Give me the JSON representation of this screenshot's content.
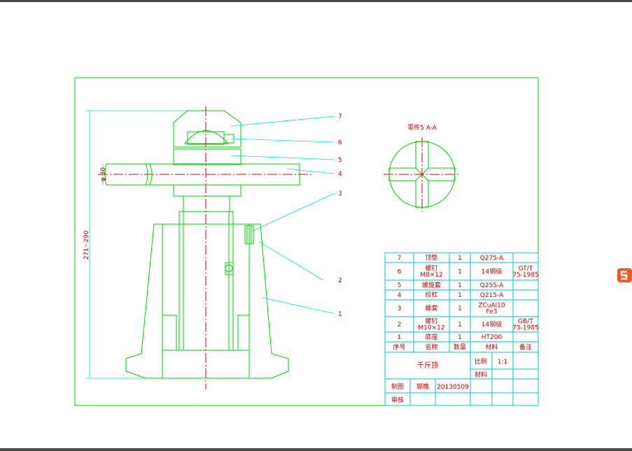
{
  "drawing": {
    "title": "千斤顶",
    "section_label": "零件5 A-A",
    "dim_height": "271~290",
    "dim_diameter": "φ 30",
    "leaders": [
      "7",
      "6",
      "5",
      "4",
      "3",
      "2",
      "1"
    ]
  },
  "bom": {
    "rows": [
      {
        "no": "7",
        "name": "顶垫",
        "qty": "1",
        "material": "Q275-A",
        "note": ""
      },
      {
        "no": "6",
        "name": "螺钉 M8×12",
        "qty": "1",
        "material": "14钢级",
        "note": "GT/T 75-1985"
      },
      {
        "no": "5",
        "name": "螺旋套",
        "qty": "1",
        "material": "Q255-A",
        "note": ""
      },
      {
        "no": "4",
        "name": "绞杠",
        "qty": "1",
        "material": "Q215-A",
        "note": ""
      },
      {
        "no": "3",
        "name": "螺套",
        "qty": "1",
        "material": "ZCuAl10 Fe3",
        "note": ""
      },
      {
        "no": "2",
        "name": "螺钉 M10×12",
        "qty": "1",
        "material": "14钢级",
        "note": "GB/T 73-1985"
      },
      {
        "no": "1",
        "name": "底座",
        "qty": "1",
        "material": "HT200",
        "note": ""
      }
    ],
    "header": {
      "no": "序号",
      "name": "名称",
      "qty": "数量",
      "material": "材料",
      "note": "备注"
    }
  },
  "title_block": {
    "name": "千斤顶",
    "scale_label": "比例",
    "scale_value": "1:1",
    "material_label": "材料",
    "drawn_label": "制图",
    "drawn_by": "郭晚",
    "date": "20130509",
    "check_label": "审核"
  },
  "colors": {
    "outline": "#00d000",
    "center": "#e00000",
    "dimension": "#00e0e0",
    "text": "#cc0000"
  }
}
